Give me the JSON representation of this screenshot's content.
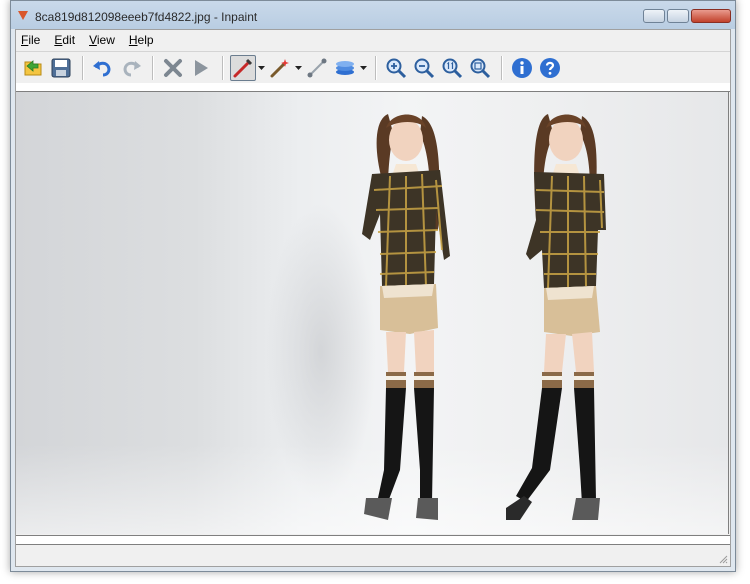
{
  "window": {
    "title": "8ca819d812098eeeb7fd4822.jpg - Inpaint"
  },
  "menu": {
    "items": [
      {
        "label": "File",
        "mnemonic": "F",
        "rest": "ile"
      },
      {
        "label": "Edit",
        "mnemonic": "E",
        "rest": "dit"
      },
      {
        "label": "View",
        "mnemonic": "V",
        "rest": "iew"
      },
      {
        "label": "Help",
        "mnemonic": "H",
        "rest": "elp"
      }
    ]
  },
  "toolbar": {
    "tools": [
      "open-icon",
      "save-icon",
      "undo-icon",
      "redo-icon",
      "erase-icon",
      "run-icon",
      "marker-icon",
      "magic-wand-icon",
      "line-icon",
      "layers-icon",
      "zoom-in-icon",
      "zoom-out-icon",
      "zoom-actual-icon",
      "zoom-fit-icon",
      "info-icon",
      "help-icon"
    ],
    "active_tool": "marker-icon"
  },
  "colors": {
    "accent_blue": "#2f6fd1",
    "title_bg": "#c9d9ea",
    "canvas_bg": "#e8e9eb"
  }
}
